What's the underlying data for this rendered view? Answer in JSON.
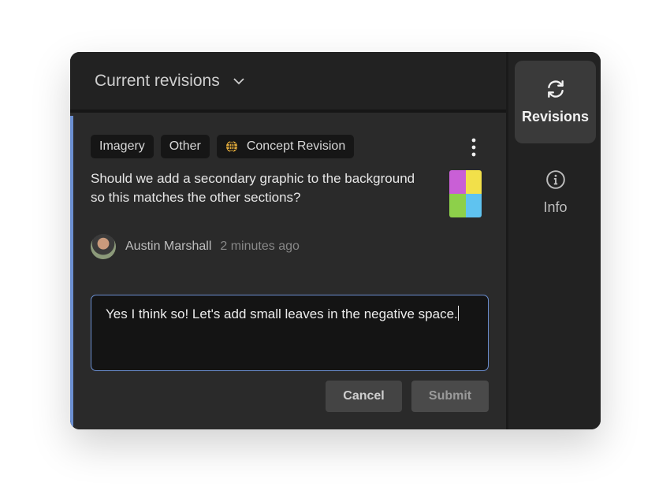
{
  "header": {
    "title": "Current revisions"
  },
  "revision": {
    "tags": [
      {
        "label": "Imagery"
      },
      {
        "label": "Other"
      },
      {
        "label": "Concept Revision",
        "icon": "globe-icon"
      }
    ],
    "question": "Should we add a secondary graphic to the background so this matches the other sections?",
    "author": "Austin Marshall",
    "time": "2 minutes ago"
  },
  "reply": {
    "value": "Yes I think so! Let's add small leaves in the negative space."
  },
  "actions": {
    "cancel": "Cancel",
    "submit": "Submit"
  },
  "sidebar": {
    "items": [
      {
        "label": "Revisions",
        "icon": "refresh-icon",
        "active": true
      },
      {
        "label": "Info",
        "icon": "info-icon",
        "active": false
      }
    ]
  },
  "colors": {
    "accent": "#6b8fd1",
    "background": "#2a2a2a",
    "globe": "#e0a93a"
  }
}
